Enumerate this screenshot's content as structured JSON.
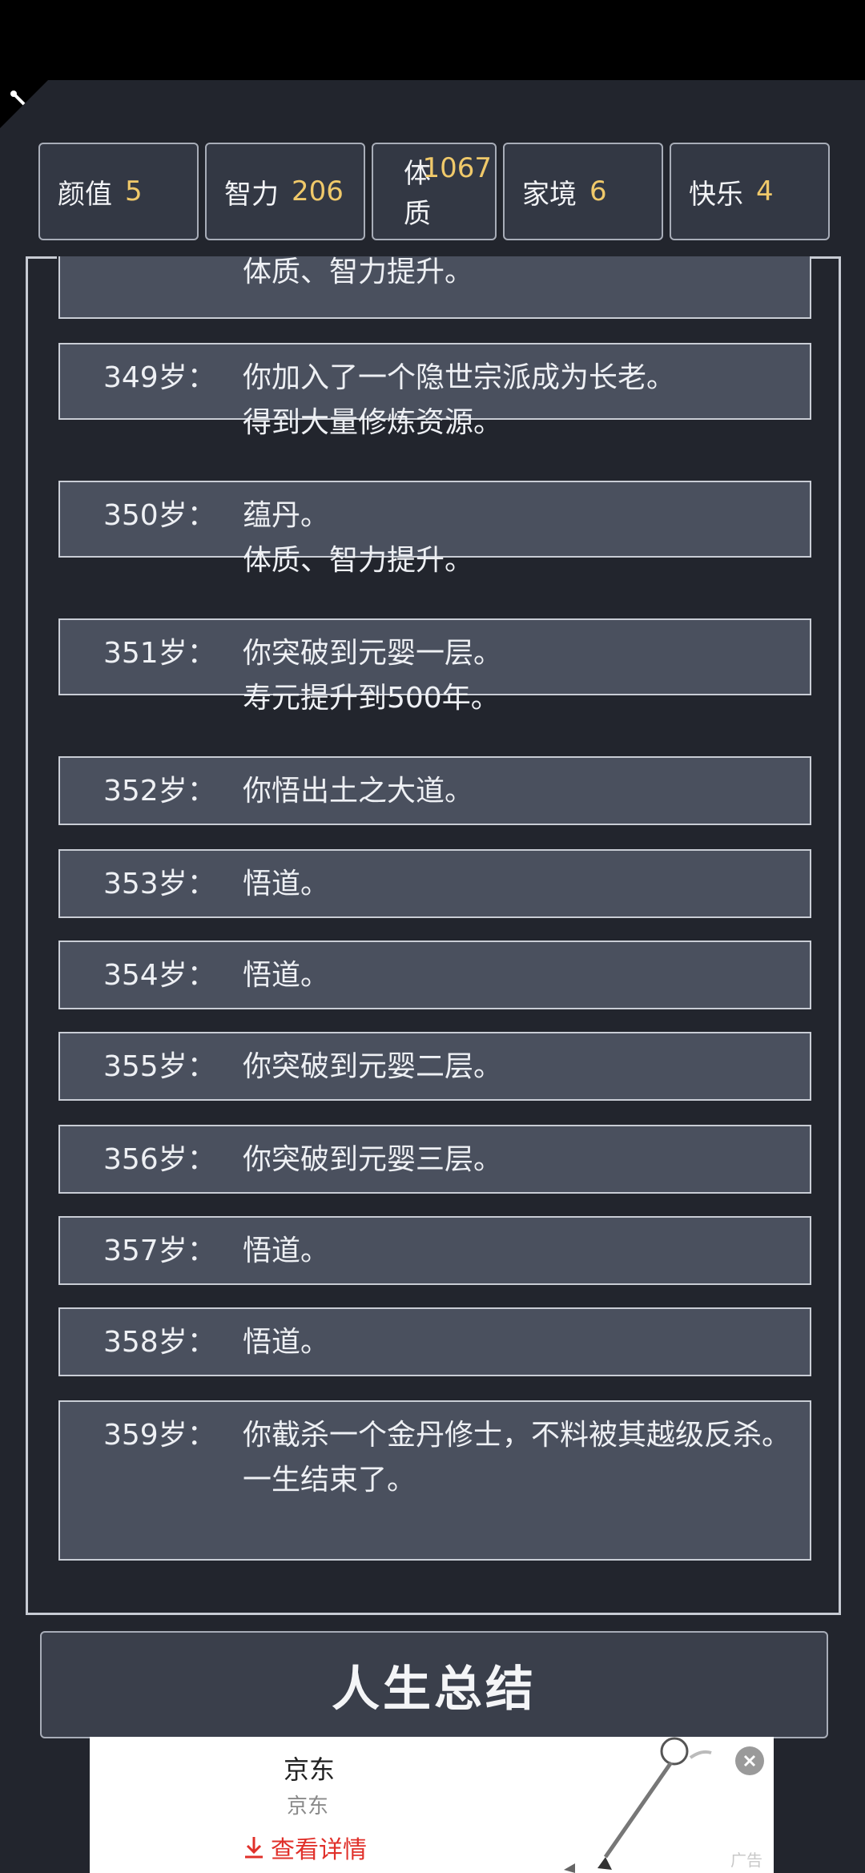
{
  "stats": [
    {
      "label": "颜值",
      "value": "5"
    },
    {
      "label": "智力",
      "value": "206"
    },
    {
      "label": "体质",
      "value": "1067"
    },
    {
      "label": "家境",
      "value": "6"
    },
    {
      "label": "快乐",
      "value": "4"
    }
  ],
  "log": {
    "partial_entry": {
      "text": "体质、智力提升。"
    },
    "entries": [
      {
        "age": "349岁：",
        "text": "你加入了一个隐世宗派成为长老。",
        "extra": "得到大量修炼资源。"
      },
      {
        "age": "350岁：",
        "text": "蕴丹。",
        "extra": "体质、智力提升。"
      },
      {
        "age": "351岁：",
        "text": "你突破到元婴一层。",
        "extra": "寿元提升到500年。"
      },
      {
        "age": "352岁：",
        "text": "你悟出土之大道。",
        "extra": ""
      },
      {
        "age": "353岁：",
        "text": "悟道。",
        "extra": ""
      },
      {
        "age": "354岁：",
        "text": "悟道。",
        "extra": ""
      },
      {
        "age": "355岁：",
        "text": "你突破到元婴二层。",
        "extra": ""
      },
      {
        "age": "356岁：",
        "text": "你突破到元婴三层。",
        "extra": ""
      },
      {
        "age": "357岁：",
        "text": "悟道。",
        "extra": ""
      },
      {
        "age": "358岁：",
        "text": "悟道。",
        "extra": ""
      },
      {
        "age": "359岁：",
        "text": "你截杀一个金丹修士，不料被其越级反杀。",
        "extra": "一生结束了。"
      }
    ]
  },
  "summary_button": {
    "label": "人生总结"
  },
  "ad": {
    "title": "京东",
    "subtitle": "京东",
    "detail_label": "查看详情",
    "tag": "广告"
  }
}
